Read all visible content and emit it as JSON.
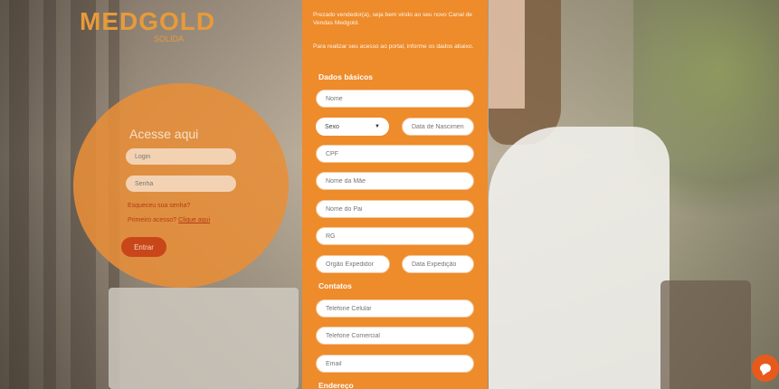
{
  "brand": {
    "logo_main": "MEDGOLD",
    "logo_sub": "SOLIDA"
  },
  "login": {
    "title": "Acesse aqui",
    "user_placeholder": "Login",
    "password_placeholder": "Senha",
    "forgot_link": "Esqueceu sua senha?",
    "register_prefix": "Primeiro acesso?",
    "register_link": "Clique aqui",
    "enter_label": "Entrar"
  },
  "signup": {
    "intro_1": "Prezado vendedor(a), seja bem vindo ao seu novo Canal de Vendas Medgold.",
    "intro_2": "Para realizar seu acesso ao portal, informe os dados abaixo.",
    "section_basic": "Dados básicos",
    "name_placeholder": "Nome",
    "sex_selected": "Sexo",
    "birth_placeholder": "Data de Nascimento",
    "cpf_placeholder": "CPF",
    "mother_placeholder": "Nome da Mãe",
    "father_placeholder": "Nome do Pai",
    "rg_placeholder": "RG",
    "issuer_placeholder": "Órgão Expedidor",
    "issue_date_placeholder": "Data Expedição",
    "section_contacts": "Contatos",
    "mobile_placeholder": "Telefone Celular",
    "work_phone_placeholder": "Telefone Comercial",
    "email_placeholder": "Email",
    "section_address": "Endereço"
  },
  "colors": {
    "accent": "#ee8b2a",
    "button": "#c9461a",
    "chat": "#e85a1c"
  },
  "icons": {
    "chat": "chat-bubble-icon",
    "dropdown": "chevron-down-icon"
  }
}
